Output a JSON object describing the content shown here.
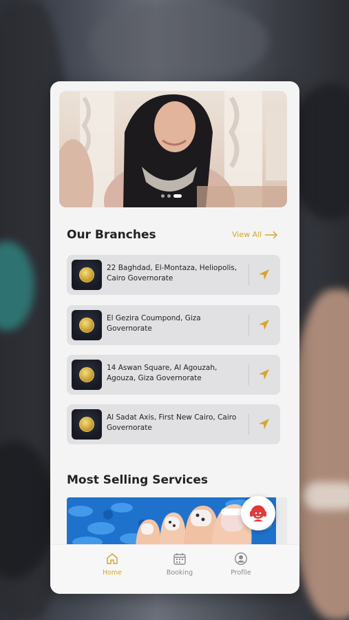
{
  "branches_section": {
    "title": "Our Branches",
    "view_all": "View All"
  },
  "branches": [
    {
      "address": "22 Baghdad, El-Montaza, Heliopolis, Cairo Governorate"
    },
    {
      "address": "El Gezira Coumpond, Giza Governorate"
    },
    {
      "address": "14 Aswan Square, Al Agouzah, Agouza, Giza Governorate"
    },
    {
      "address": "Al Sadat Axis, First New Cairo, Cairo Governorate"
    }
  ],
  "services_section": {
    "title": "Most Selling Services"
  },
  "carousel": {
    "slides": 3,
    "active": 3
  },
  "tabs": [
    {
      "label": "Home",
      "icon": "home-icon",
      "active": true
    },
    {
      "label": "Booking",
      "icon": "calendar-icon",
      "active": false
    },
    {
      "label": "Profile",
      "icon": "profile-icon",
      "active": false
    }
  ],
  "colors": {
    "accent": "#d4a62a",
    "support_red": "#e03b3b",
    "card_bg": "#f4f4f5",
    "row_bg": "#e1e1e3"
  }
}
